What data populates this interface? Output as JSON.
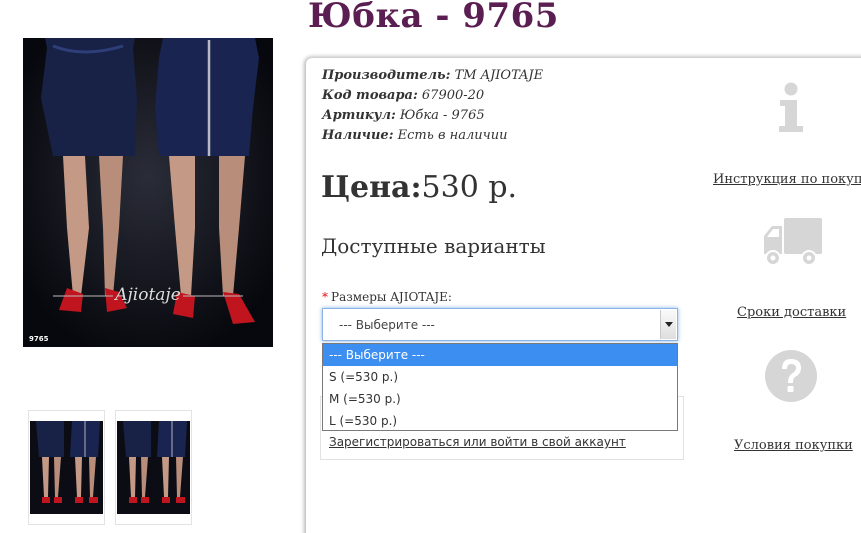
{
  "product": {
    "title": "Юбка - 9765",
    "photo_label": "9765",
    "brand_watermark": "Ajiotaje"
  },
  "meta": {
    "manufacturer_label": "Производитель:",
    "manufacturer_value": "ТМ AJIOTAJE",
    "code_label": "Код товара:",
    "code_value": "67900-20",
    "article_label": "Артикул:",
    "article_value": "Юбка - 9765",
    "stock_label": "Наличие:",
    "stock_value": "Есть в наличии"
  },
  "price": {
    "label": "Цена:",
    "value": "530 р."
  },
  "variants": {
    "heading": "Доступные варианты",
    "size_required_mark": "*",
    "size_label": "Размеры AJIOTAJE:",
    "selected": "--- Выберите ---",
    "options": [
      "--- Выберите ---",
      "S (=530 р.)",
      "M (=530 р.)",
      "L (=530 р.)"
    ]
  },
  "login": {
    "link": "Зарегистрироваться или войти в свой аккаунт"
  },
  "side": {
    "instructions": "Инструкция по покупке",
    "delivery": "Сроки доставки",
    "terms": "Условия покупки"
  },
  "colors": {
    "title": "#5a1e52",
    "highlight": "#3c8ef0",
    "icon_gray": "#d6d6d6"
  }
}
